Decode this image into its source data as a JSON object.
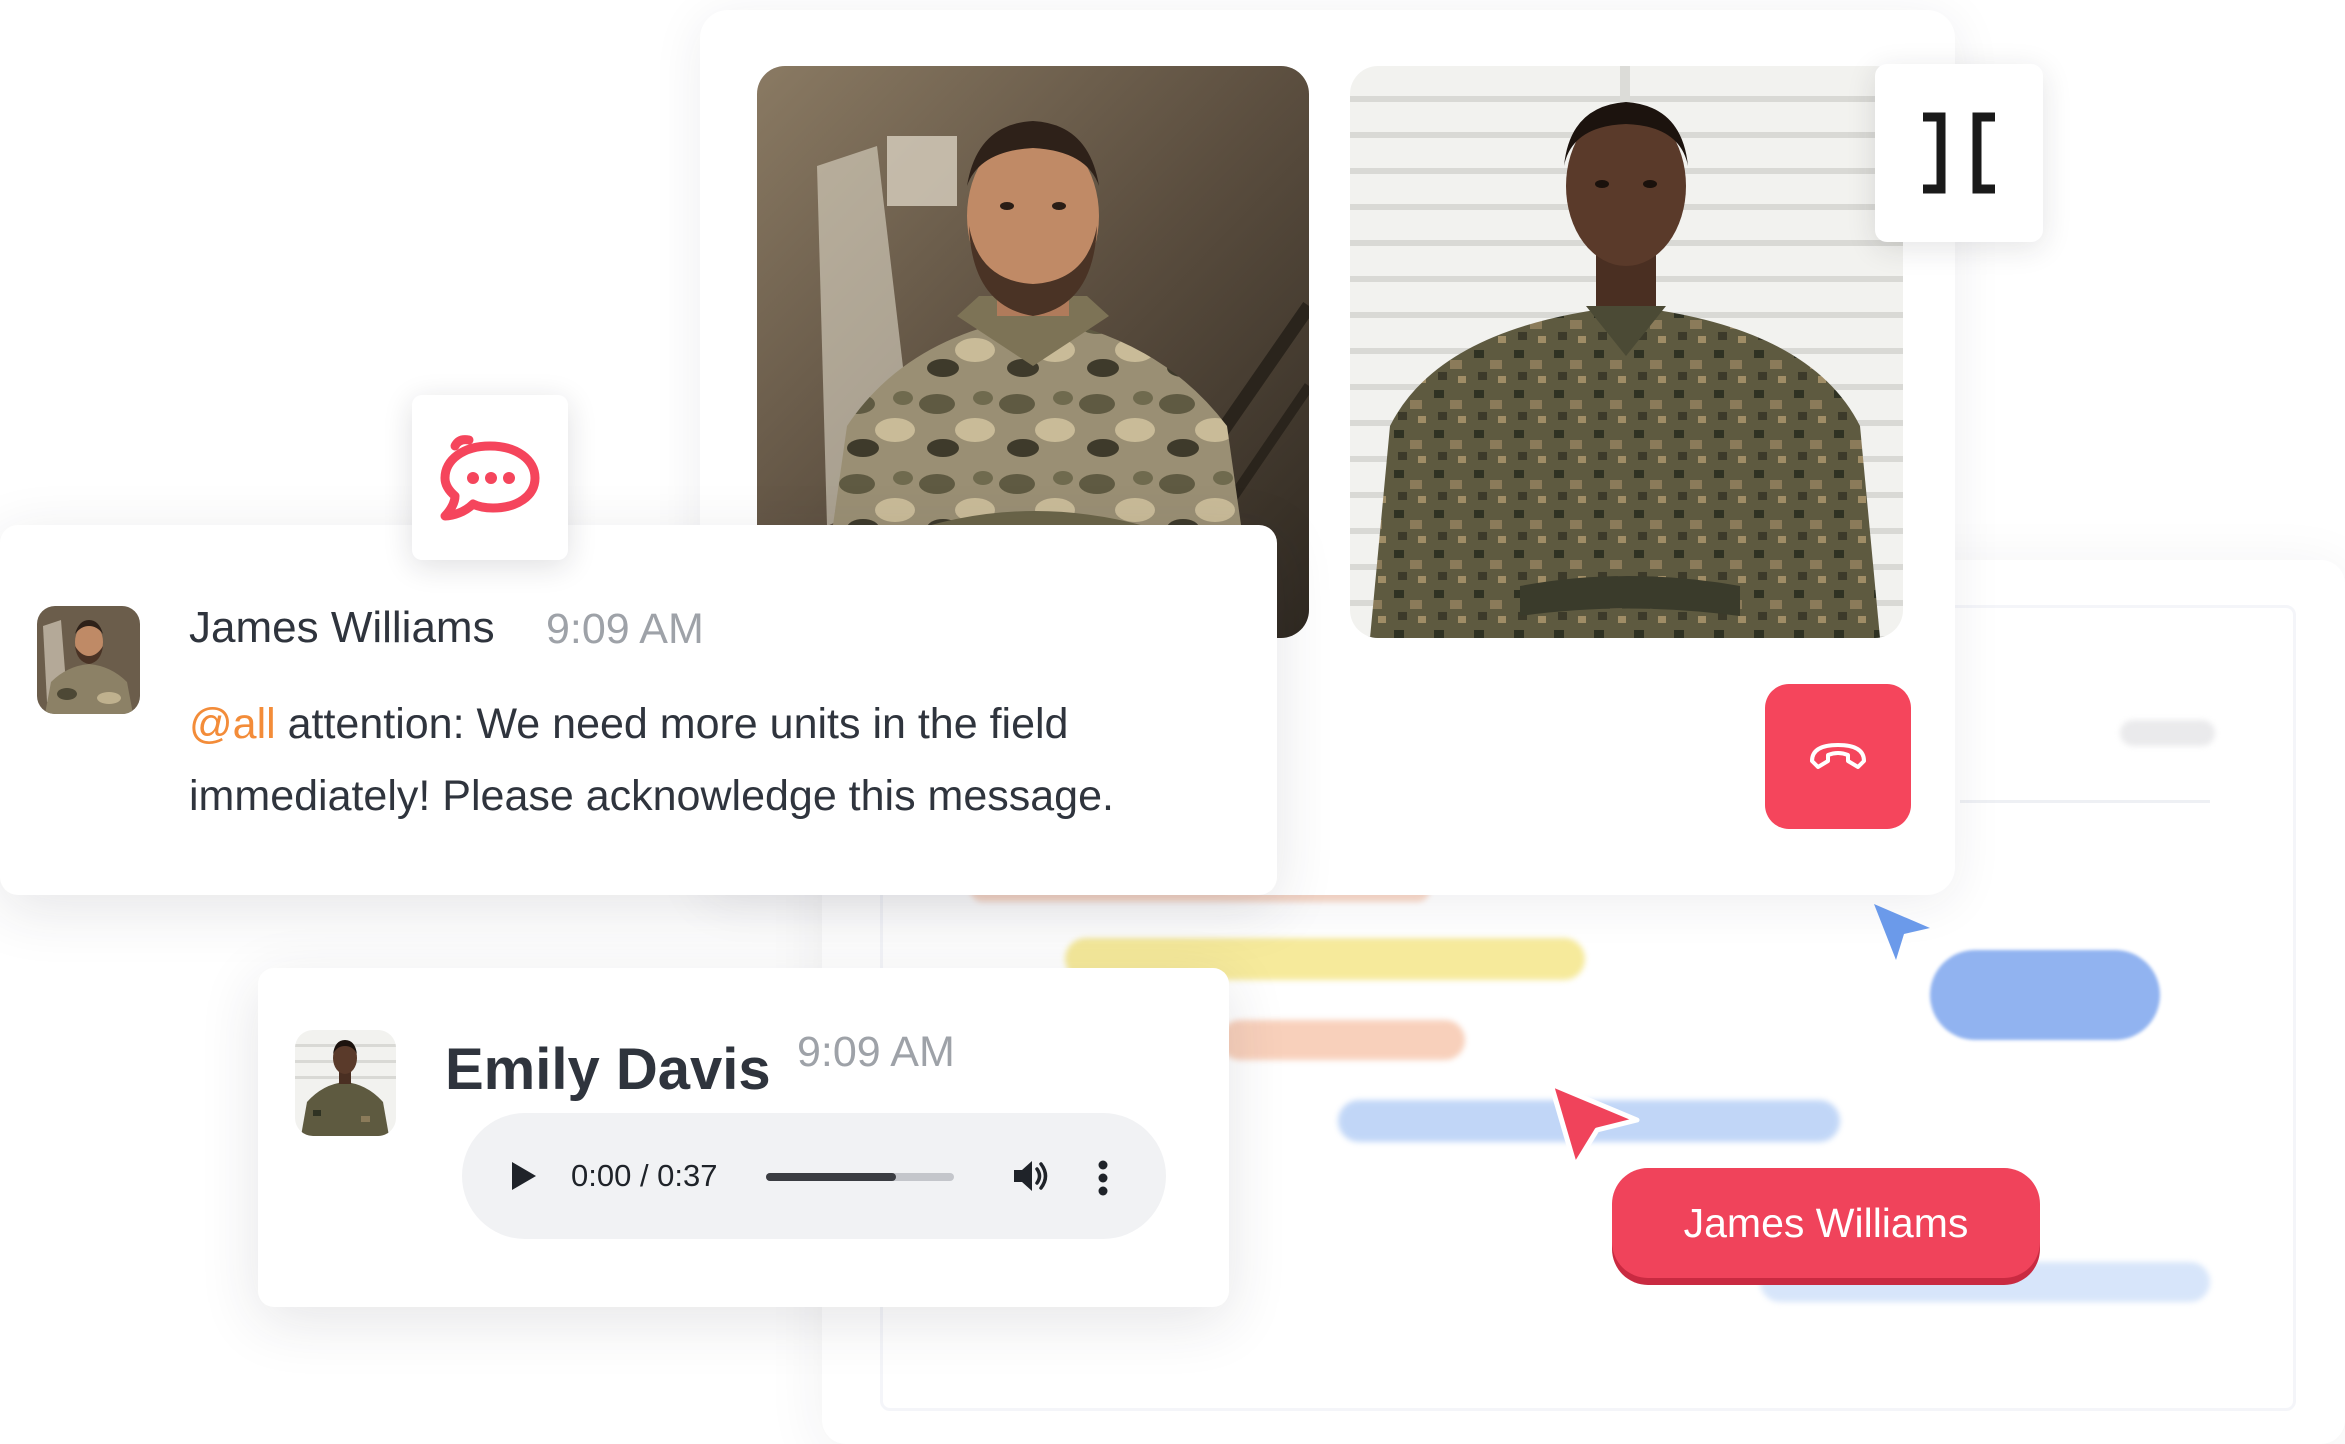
{
  "colors": {
    "accent_red": "#f5455c",
    "mention_orange": "#f38c39",
    "text_primary": "#2f343d",
    "text_muted": "#9ea2a8"
  },
  "call": {
    "icons": {
      "layout": "collapse-brackets-icon",
      "hangup": "hang-up-phone-icon"
    }
  },
  "logo": {
    "icon": "chat-bubble-logo-icon"
  },
  "message": {
    "author": "James Williams",
    "time": "9:09 AM",
    "mention": "@all",
    "text": " attention: We need more units in the field immediately! Please acknowledge this message."
  },
  "audio_message": {
    "author": "Emily Davis",
    "time": "9:09 AM",
    "player": {
      "time_display": "0:00 / 0:37",
      "progress_fraction": 0.69,
      "icons": {
        "play": "play-icon",
        "volume": "volume-icon",
        "more": "more-vertical-icon"
      }
    }
  },
  "collab_cursor": {
    "label": "James Williams"
  }
}
